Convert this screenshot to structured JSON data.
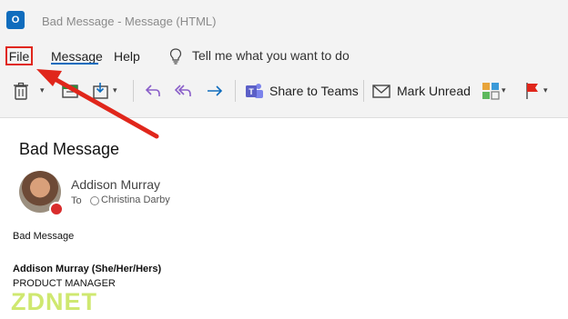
{
  "window": {
    "title": "Bad Message  -  Message (HTML)",
    "app_icon": "O"
  },
  "menu": {
    "file": "File",
    "message": "Message",
    "help": "Help",
    "tell_me": "Tell me what you want to do"
  },
  "toolbar": {
    "share_to_teams": "Share to Teams",
    "mark_unread": "Mark Unread"
  },
  "email": {
    "subject": "Bad Message",
    "sender": "Addison Murray",
    "to_label": "To",
    "recipient": "Christina Darby",
    "body_line": "Bad Message",
    "signature_name": "Addison Murray (She/Her/Hers)",
    "signature_title": "PRODUCT MANAGER"
  },
  "watermark": "ZDNET",
  "colors": {
    "accent": "#0f6cbd",
    "highlight": "#e0261b",
    "presence_busy": "#d92c2c",
    "teams": "#5b5fc7"
  }
}
